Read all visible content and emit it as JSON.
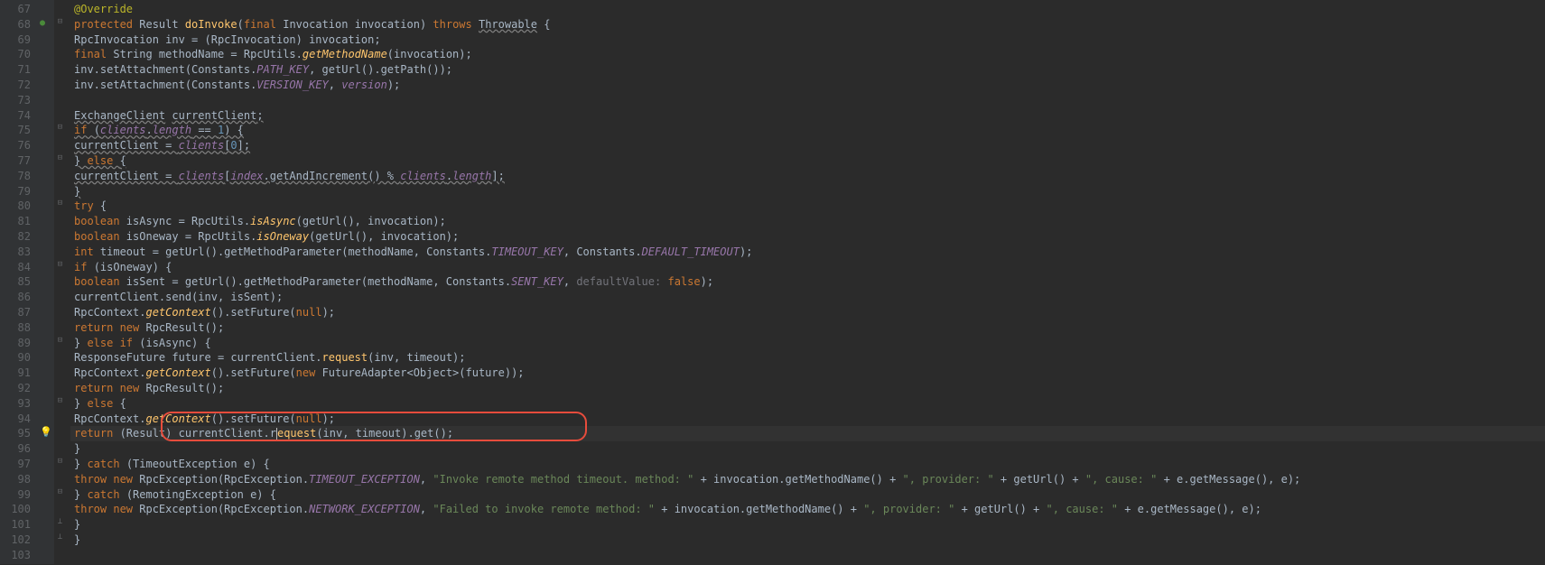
{
  "lines": {
    "start": 67,
    "end": 103
  },
  "gutter_icons": {
    "68": "override",
    "95": "bulb"
  },
  "highlighted_line": 95,
  "red_box": {
    "top_line": 94,
    "bottom_line": 95
  },
  "code": {
    "67": [
      {
        "t": "    ",
        "c": ""
      },
      {
        "t": "@Override",
        "c": "anno"
      }
    ],
    "68": [
      {
        "t": "    ",
        "c": ""
      },
      {
        "t": "protected ",
        "c": "kw"
      },
      {
        "t": "Result ",
        "c": "type"
      },
      {
        "t": "doInvoke",
        "c": "method"
      },
      {
        "t": "(",
        "c": ""
      },
      {
        "t": "final ",
        "c": "kw"
      },
      {
        "t": "Invocation ",
        "c": "type"
      },
      {
        "t": "invocation",
        "c": "param"
      },
      {
        "t": ") ",
        "c": ""
      },
      {
        "t": "throws ",
        "c": "kw"
      },
      {
        "t": "Throwable",
        "c": "warn-underline"
      },
      {
        "t": " {",
        "c": ""
      }
    ],
    "69": [
      {
        "t": "        RpcInvocation inv = (RpcInvocation) invocation;",
        "c": ""
      }
    ],
    "70": [
      {
        "t": "        ",
        "c": ""
      },
      {
        "t": "final ",
        "c": "kw"
      },
      {
        "t": "String methodName = RpcUtils.",
        "c": ""
      },
      {
        "t": "getMethodName",
        "c": "static-method"
      },
      {
        "t": "(invocation);",
        "c": ""
      }
    ],
    "71": [
      {
        "t": "        inv.setAttachment(Constants.",
        "c": ""
      },
      {
        "t": "PATH_KEY",
        "c": "const"
      },
      {
        "t": ", getUrl().getPath());",
        "c": ""
      }
    ],
    "72": [
      {
        "t": "        inv.setAttachment(Constants.",
        "c": ""
      },
      {
        "t": "VERSION_KEY",
        "c": "const"
      },
      {
        "t": ", ",
        "c": ""
      },
      {
        "t": "version",
        "c": "field"
      },
      {
        "t": ");",
        "c": ""
      }
    ],
    "73": [
      {
        "t": "",
        "c": ""
      }
    ],
    "74": [
      {
        "t": "        ",
        "c": ""
      },
      {
        "t": "ExchangeClient",
        "c": "warn-underline"
      },
      {
        "t": " ",
        "c": ""
      },
      {
        "t": "currentClient",
        "c": "warn-underline"
      },
      {
        "t": ";",
        "c": "warn-underline"
      }
    ],
    "75": [
      {
        "t": "        ",
        "c": ""
      },
      {
        "t": "if ",
        "c": "kw warn-underline"
      },
      {
        "t": "(",
        "c": "warn-underline"
      },
      {
        "t": "clients",
        "c": "field warn-underline"
      },
      {
        "t": ".",
        "c": "warn-underline"
      },
      {
        "t": "length",
        "c": "field warn-underline"
      },
      {
        "t": " == ",
        "c": "warn-underline"
      },
      {
        "t": "1",
        "c": "num warn-underline"
      },
      {
        "t": ") {",
        "c": "warn-underline"
      }
    ],
    "76": [
      {
        "t": "            ",
        "c": ""
      },
      {
        "t": "currentClient = ",
        "c": "warn-underline"
      },
      {
        "t": "clients",
        "c": "field warn-underline"
      },
      {
        "t": "[",
        "c": "warn-underline"
      },
      {
        "t": "0",
        "c": "num warn-underline"
      },
      {
        "t": "];",
        "c": "warn-underline"
      }
    ],
    "77": [
      {
        "t": "        ",
        "c": ""
      },
      {
        "t": "} ",
        "c": "warn-underline"
      },
      {
        "t": "else ",
        "c": "kw warn-underline"
      },
      {
        "t": "{",
        "c": "warn-underline"
      }
    ],
    "78": [
      {
        "t": "            ",
        "c": ""
      },
      {
        "t": "currentClient = ",
        "c": "warn-underline"
      },
      {
        "t": "clients",
        "c": "field warn-underline"
      },
      {
        "t": "[",
        "c": "warn-underline"
      },
      {
        "t": "index",
        "c": "field warn-underline"
      },
      {
        "t": ".getAndIncrement() % ",
        "c": "warn-underline"
      },
      {
        "t": "clients",
        "c": "field warn-underline"
      },
      {
        "t": ".",
        "c": "warn-underline"
      },
      {
        "t": "length",
        "c": "field warn-underline"
      },
      {
        "t": "];",
        "c": "warn-underline"
      }
    ],
    "79": [
      {
        "t": "        ",
        "c": ""
      },
      {
        "t": "}",
        "c": "warn-underline"
      }
    ],
    "80": [
      {
        "t": "        ",
        "c": ""
      },
      {
        "t": "try ",
        "c": "kw"
      },
      {
        "t": "{",
        "c": ""
      }
    ],
    "81": [
      {
        "t": "            ",
        "c": ""
      },
      {
        "t": "boolean ",
        "c": "kw"
      },
      {
        "t": "isAsync = RpcUtils.",
        "c": ""
      },
      {
        "t": "isAsync",
        "c": "static-method"
      },
      {
        "t": "(getUrl(), invocation);",
        "c": ""
      }
    ],
    "82": [
      {
        "t": "            ",
        "c": ""
      },
      {
        "t": "boolean ",
        "c": "kw"
      },
      {
        "t": "isOneway = RpcUtils.",
        "c": ""
      },
      {
        "t": "isOneway",
        "c": "static-method"
      },
      {
        "t": "(getUrl(), invocation);",
        "c": ""
      }
    ],
    "83": [
      {
        "t": "            ",
        "c": ""
      },
      {
        "t": "int ",
        "c": "kw"
      },
      {
        "t": "timeout = getUrl().getMethodParameter(methodName, Constants.",
        "c": ""
      },
      {
        "t": "TIMEOUT_KEY",
        "c": "const"
      },
      {
        "t": ", Constants.",
        "c": ""
      },
      {
        "t": "DEFAULT_TIMEOUT",
        "c": "const"
      },
      {
        "t": ");",
        "c": ""
      }
    ],
    "84": [
      {
        "t": "            ",
        "c": ""
      },
      {
        "t": "if ",
        "c": "kw"
      },
      {
        "t": "(isOneway) {",
        "c": ""
      }
    ],
    "85": [
      {
        "t": "                ",
        "c": ""
      },
      {
        "t": "boolean ",
        "c": "kw"
      },
      {
        "t": "isSent = getUrl().getMethodParameter(methodName, Constants.",
        "c": ""
      },
      {
        "t": "SENT_KEY",
        "c": "const"
      },
      {
        "t": ",  ",
        "c": ""
      },
      {
        "t": "defaultValue: ",
        "c": "comment-hint"
      },
      {
        "t": "false",
        "c": "kw"
      },
      {
        "t": ");",
        "c": ""
      }
    ],
    "86": [
      {
        "t": "                currentClient.send(inv, isSent);",
        "c": ""
      }
    ],
    "87": [
      {
        "t": "                RpcContext.",
        "c": ""
      },
      {
        "t": "getContext",
        "c": "static-method"
      },
      {
        "t": "().setFuture(",
        "c": ""
      },
      {
        "t": "null",
        "c": "kw"
      },
      {
        "t": ");",
        "c": ""
      }
    ],
    "88": [
      {
        "t": "                ",
        "c": ""
      },
      {
        "t": "return new ",
        "c": "kw"
      },
      {
        "t": "RpcResult();",
        "c": ""
      }
    ],
    "89": [
      {
        "t": "            } ",
        "c": ""
      },
      {
        "t": "else if ",
        "c": "kw"
      },
      {
        "t": "(isAsync) {",
        "c": ""
      }
    ],
    "90": [
      {
        "t": "                ResponseFuture future = currentClient.",
        "c": ""
      },
      {
        "t": "request",
        "c": "method"
      },
      {
        "t": "(inv, timeout);",
        "c": ""
      }
    ],
    "91": [
      {
        "t": "                RpcContext.",
        "c": ""
      },
      {
        "t": "getContext",
        "c": "static-method"
      },
      {
        "t": "().setFuture(",
        "c": ""
      },
      {
        "t": "new ",
        "c": "kw"
      },
      {
        "t": "FutureAdapter<Object>(future));",
        "c": ""
      }
    ],
    "92": [
      {
        "t": "                ",
        "c": ""
      },
      {
        "t": "return new ",
        "c": "kw"
      },
      {
        "t": "RpcResult();",
        "c": ""
      }
    ],
    "93": [
      {
        "t": "            } ",
        "c": ""
      },
      {
        "t": "else ",
        "c": "kw"
      },
      {
        "t": "{",
        "c": ""
      }
    ],
    "94": [
      {
        "t": "                RpcContext.",
        "c": ""
      },
      {
        "t": "getContext",
        "c": "static-method"
      },
      {
        "t": "().setFuture(",
        "c": ""
      },
      {
        "t": "null",
        "c": "kw"
      },
      {
        "t": ");",
        "c": ""
      }
    ],
    "95": [
      {
        "t": "                ",
        "c": ""
      },
      {
        "t": "return ",
        "c": "kw"
      },
      {
        "t": "(Result) currentClient.r",
        "c": ""
      },
      {
        "t": "",
        "c": "caret-here"
      },
      {
        "t": "equest",
        "c": "method"
      },
      {
        "t": "(inv, timeout).get();",
        "c": ""
      }
    ],
    "96": [
      {
        "t": "            }",
        "c": ""
      }
    ],
    "97": [
      {
        "t": "        } ",
        "c": ""
      },
      {
        "t": "catch ",
        "c": "kw"
      },
      {
        "t": "(TimeoutException e) {",
        "c": ""
      }
    ],
    "98": [
      {
        "t": "            ",
        "c": ""
      },
      {
        "t": "throw new ",
        "c": "kw"
      },
      {
        "t": "RpcException(RpcException.",
        "c": ""
      },
      {
        "t": "TIMEOUT_EXCEPTION",
        "c": "const"
      },
      {
        "t": ", ",
        "c": ""
      },
      {
        "t": "\"Invoke remote method timeout. method: \"",
        "c": "str"
      },
      {
        "t": " + invocation.getMethodName() + ",
        "c": ""
      },
      {
        "t": "\", provider: \"",
        "c": "str"
      },
      {
        "t": " + getUrl() + ",
        "c": ""
      },
      {
        "t": "\", cause: \"",
        "c": "str"
      },
      {
        "t": " + e.getMessage(), e);",
        "c": ""
      }
    ],
    "99": [
      {
        "t": "        } ",
        "c": ""
      },
      {
        "t": "catch ",
        "c": "kw"
      },
      {
        "t": "(RemotingException e) {",
        "c": ""
      }
    ],
    "100": [
      {
        "t": "            ",
        "c": ""
      },
      {
        "t": "throw new ",
        "c": "kw"
      },
      {
        "t": "RpcException(RpcException.",
        "c": ""
      },
      {
        "t": "NETWORK_EXCEPTION",
        "c": "const"
      },
      {
        "t": ", ",
        "c": ""
      },
      {
        "t": "\"Failed to invoke remote method: \"",
        "c": "str"
      },
      {
        "t": " + invocation.getMethodName() + ",
        "c": ""
      },
      {
        "t": "\", provider: \"",
        "c": "str"
      },
      {
        "t": " + getUrl() + ",
        "c": ""
      },
      {
        "t": "\", cause: \"",
        "c": "str"
      },
      {
        "t": " + e.getMessage(), e);",
        "c": ""
      }
    ],
    "101": [
      {
        "t": "        }",
        "c": ""
      }
    ],
    "102": [
      {
        "t": "    }",
        "c": ""
      }
    ],
    "103": [
      {
        "t": "",
        "c": ""
      }
    ]
  },
  "fold_markers": {
    "68": "⊟",
    "75": "⊟",
    "77": "⊟",
    "80": "⊟",
    "84": "⊟",
    "89": "⊟",
    "93": "⊟",
    "97": "⊟",
    "99": "⊟",
    "101": "⊥",
    "102": "⊥"
  }
}
